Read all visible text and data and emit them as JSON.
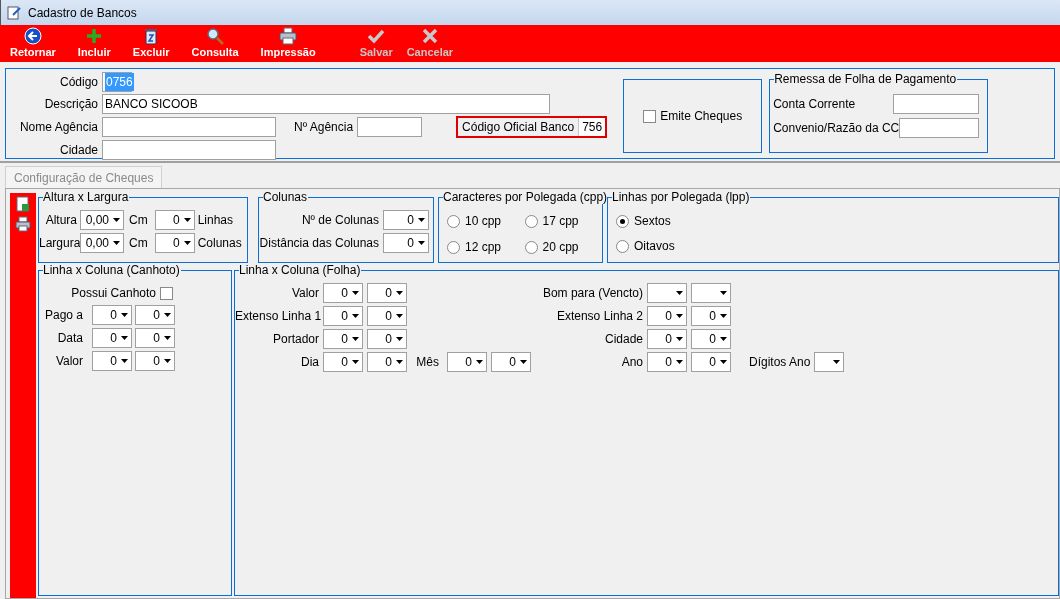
{
  "window": {
    "title": "Cadastro de Bancos"
  },
  "toolbar": [
    {
      "kind": "back",
      "label": "Retornar",
      "disabled": false
    },
    {
      "kind": "add",
      "label": "Incluir",
      "disabled": false
    },
    {
      "kind": "delete",
      "label": "Excluir",
      "disabled": false
    },
    {
      "kind": "search",
      "label": "Consulta",
      "disabled": false
    },
    {
      "kind": "print",
      "label": "Impressão",
      "disabled": false
    },
    {
      "kind": "save",
      "label": "Salvar",
      "disabled": true
    },
    {
      "kind": "cancel",
      "label": "Cancelar",
      "disabled": true
    }
  ],
  "form": {
    "codigo": {
      "label": "Código",
      "value": "0756"
    },
    "descricao": {
      "label": "Descrição",
      "value": "BANCO SICOOB"
    },
    "nome_agencia": {
      "label": "Nome Agência"
    },
    "n_agencia": {
      "label": "Nº Agência"
    },
    "codigo_oficial": {
      "label": "Código Oficial Banco",
      "value": "756"
    },
    "cidade": {
      "label": "Cidade"
    },
    "emite_cheques": {
      "label": "Emite Cheques",
      "checked": false
    },
    "remessa": {
      "title": "Remessa de Folha de Pagamento",
      "fields": [
        {
          "label": "Conta Corrente"
        },
        {
          "label": "Convenio/Razão da CC"
        }
      ]
    }
  },
  "tabs": [
    {
      "label": "Configuração de Cheques",
      "selected": false
    }
  ],
  "altura_largura": {
    "title": "Altura x Largura",
    "rows": [
      {
        "label": "Altura",
        "value": "0,00",
        "unit": "Cm",
        "count": "0",
        "count_unit": "Linhas"
      },
      {
        "label": "Largura",
        "value": "0,00",
        "unit": "Cm",
        "count": "0",
        "count_unit": "Colunas"
      }
    ]
  },
  "colunas": {
    "title": "Colunas",
    "rows": [
      {
        "label": "Nº de Colunas",
        "value": "0"
      },
      {
        "label": "Distância das Colunas",
        "value": "0"
      }
    ]
  },
  "cpp": {
    "title": "Caracteres por Polegada (cpp)",
    "options": [
      {
        "label": "10 cpp",
        "selected": false
      },
      {
        "label": "17 cpp",
        "selected": false
      },
      {
        "label": "12 cpp",
        "selected": false
      },
      {
        "label": "20 cpp",
        "selected": false
      }
    ]
  },
  "lpp": {
    "title": "Linhas por Polegada (lpp)",
    "options": [
      {
        "label": "Sextos",
        "selected": true
      },
      {
        "label": "Oitavos",
        "selected": false
      }
    ]
  },
  "canhoto": {
    "title": "Linha x Coluna (Canhoto)",
    "possui": {
      "label": "Possui Canhoto",
      "checked": false
    },
    "rows": [
      {
        "label": "Pago a",
        "values": [
          "0",
          "0"
        ]
      },
      {
        "label": "Data",
        "values": [
          "0",
          "0"
        ]
      },
      {
        "label": "Valor",
        "values": [
          "0",
          "0"
        ]
      }
    ]
  },
  "folha": {
    "title": "Linha x Coluna (Folha)",
    "rows": [
      {
        "left": {
          "label": "Valor",
          "values": [
            {
              "kind": "value",
              "value": "0"
            },
            {
              "kind": "value",
              "value": "0"
            }
          ]
        },
        "right": {
          "label": "Bom para (Vencto)",
          "values": [
            {
              "kind": "blank"
            },
            {
              "kind": "blank"
            }
          ]
        }
      },
      {
        "left": {
          "label": "Extenso Linha 1",
          "values": [
            {
              "kind": "value",
              "value": "0"
            },
            {
              "kind": "value",
              "value": "0"
            }
          ]
        },
        "right": {
          "label": "Extenso Linha 2",
          "values": [
            {
              "kind": "value",
              "value": "0"
            },
            {
              "kind": "value",
              "value": "0"
            }
          ]
        }
      },
      {
        "left": {
          "label": "Portador",
          "values": [
            {
              "kind": "value",
              "value": "0"
            },
            {
              "kind": "value",
              "value": "0"
            }
          ]
        },
        "right": {
          "label": "Cidade",
          "values": [
            {
              "kind": "value",
              "value": "0"
            },
            {
              "kind": "value",
              "value": "0"
            }
          ]
        }
      },
      {
        "left": {
          "label": "Dia",
          "values": [
            {
              "kind": "value",
              "value": "0"
            },
            {
              "kind": "value",
              "value": "0"
            }
          ]
        },
        "middle": {
          "label": "Mês",
          "values": [
            {
              "kind": "value",
              "value": "0"
            },
            {
              "kind": "value",
              "value": "0"
            }
          ]
        },
        "right": {
          "label": "Ano",
          "values": [
            {
              "kind": "value",
              "value": "0"
            },
            {
              "kind": "value",
              "value": "0"
            }
          ]
        },
        "extra": {
          "label": "Dígitos Ano",
          "values": [
            {
              "kind": "blank"
            }
          ]
        }
      }
    ]
  }
}
